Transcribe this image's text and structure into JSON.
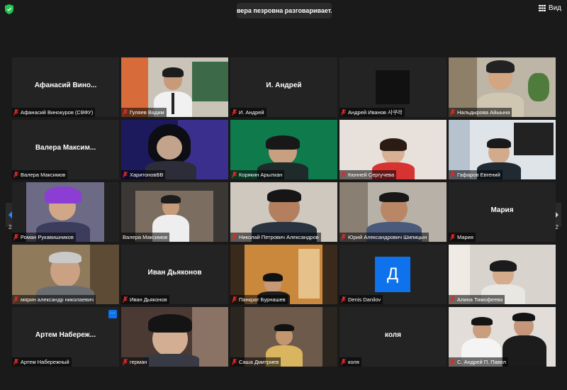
{
  "header": {
    "speaker_text": "вера пезровна разговаривает...",
    "view_label": "Вид"
  },
  "pagination": {
    "left": "2/2",
    "right": "2/2"
  },
  "colors": {
    "accent": "#0e72ed",
    "muted_mic": "#e02828",
    "tile_bg": "#232323"
  },
  "tiles": [
    {
      "name": "Афанасий Винокуров (СВФУ)",
      "center": "Афанасий  Вино..."
    },
    {
      "name": "Гуляев Вадим"
    },
    {
      "name": "И. Андрей",
      "center": "И. Андрей"
    },
    {
      "name": "Андрей Иванов 사쿠라"
    },
    {
      "name": "Нальдырова Айыына"
    },
    {
      "name": "Валера Максимов",
      "center": "Валера  Максим..."
    },
    {
      "name": "ХаритоновВВ"
    },
    {
      "name": "Корякин Арылхан"
    },
    {
      "name": "Кюнней Сергучева"
    },
    {
      "name": "Гафаров Евгений"
    },
    {
      "name": "Роман Рукавишников"
    },
    {
      "name": "Валера Максимов"
    },
    {
      "name": "Николай Петрович Александров"
    },
    {
      "name": "Юрий Александрович Шипицын"
    },
    {
      "name": "Мария",
      "center": "Мария"
    },
    {
      "name": "мярин александр николаевич"
    },
    {
      "name": "Иван Дьяконов",
      "center": "Иван Дьяконов"
    },
    {
      "name": "Панкрат Бурнашев"
    },
    {
      "name": "Denis Danilov",
      "avatar": "Д"
    },
    {
      "name": "Алина Тимофеева"
    },
    {
      "name": "Артем Набережный",
      "center": "Артем  Набереж...",
      "more": "···"
    },
    {
      "name": "герман"
    },
    {
      "name": "Саша Дмитриев"
    },
    {
      "name": "коля",
      "center": "коля"
    },
    {
      "name": "С. Андрей П. Павел"
    }
  ]
}
